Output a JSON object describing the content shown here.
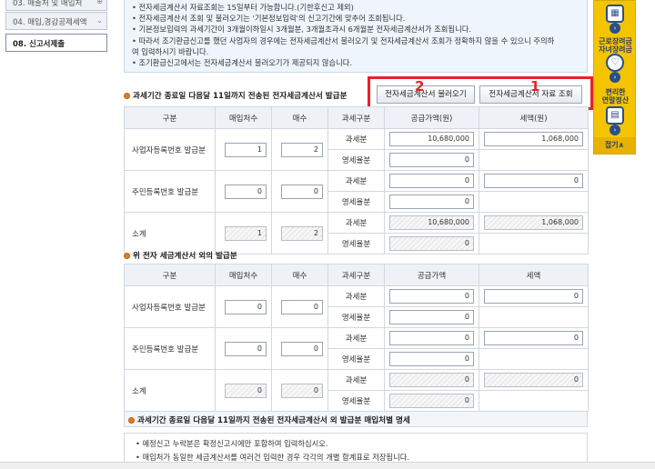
{
  "nav": {
    "item_partial": "03. 매출처 및 매입처",
    "item_deduction": "04. 매입,경감공제세액",
    "item_submit": "08. 신고서제출"
  },
  "notice": [
    "전자세금계산서 자료조회는 15일부터 가능합니다.(기한후신고 제외)",
    "전자세금계산서 조회 및 불러오기는 '기본정보입력'의 신고기간에 맞추어 조회됩니다.",
    "기본정보입력의 과세기간이 3개월이하일시 3개월분, 3개월초과시 6개월분 전자세금계산서가 조회됩니다.",
    "따라서 조기환급신고를 했던 사업자의 경우에는 전자세금계산서 불러오기 및 전자세금계산서 조회가 정확하지 않을 수 있으니 주의하",
    "여 입력하시기 바랍니다.",
    "조기환급신고에서는 전자세금계산서 불러오기가 제공되지 않습니다."
  ],
  "section1_title": "과세기간 종료일 다음달 11일까지 전송된 전자세금계산서 발급분",
  "buttons": {
    "load": "전자세금계산서 불러오기",
    "query": "전자세금계산서 자료 조회"
  },
  "marks": {
    "one": "1",
    "two": "2"
  },
  "table1": {
    "headers": [
      "구분",
      "매입처수",
      "매수",
      "과세구분",
      "공급가액(원)",
      "세액(원)"
    ],
    "rows": [
      {
        "label": "사업자등록번호 발급분",
        "count": "1",
        "sheets": "2",
        "tax_type": "과세분",
        "supply": "10,680,000",
        "tax": "1,068,000",
        "zero_type": "영세율분",
        "zero_supply": "0"
      },
      {
        "label": "주민등록번호 발급분",
        "count": "0",
        "sheets": "0",
        "tax_type": "과세분",
        "supply": "0",
        "tax": "0",
        "zero_type": "영세율분",
        "zero_supply": "0"
      },
      {
        "label": "소계",
        "count": "1",
        "sheets": "2",
        "tax_type": "과세분",
        "supply": "10,680,000",
        "tax": "1,068,000",
        "zero_type": "영세율분",
        "zero_supply": "0"
      }
    ]
  },
  "section2_title": "위 전자 세금계산서 외의 발급분",
  "table2": {
    "headers": [
      "구분",
      "매입처수",
      "매수",
      "과세구분",
      "공급가액",
      "세액"
    ],
    "rows": [
      {
        "label": "사업자등록번호 발급분",
        "count": "0",
        "sheets": "0",
        "tax_type": "과세분",
        "supply": "0",
        "tax": "0",
        "zero_type": "영세율분",
        "zero_supply": "0"
      },
      {
        "label": "주민등록번호 발급분",
        "count": "0",
        "sheets": "0",
        "tax_type": "과세분",
        "supply": "0",
        "tax": "0",
        "zero_type": "영세율분",
        "zero_supply": "0"
      },
      {
        "label": "소계",
        "count": "0",
        "sheets": "0",
        "tax_type": "과세분",
        "supply": "0",
        "tax": "0",
        "zero_type": "영세율분",
        "zero_supply": "0"
      }
    ]
  },
  "section3_title": "과세기간 종료일 다음달 11일까지 전송된 전자세금계산서 외 발급분 매입처별 명세",
  "notes": [
    "예정신고 누락분은 확정신고시에만 포함하여 입력하십시오.",
    "매입처가 동일한 세금계산서를 여러건 입력한 경우 각각의 개별 합계표로 저장됩니다."
  ],
  "rpanel": {
    "refund": "근로장려금\n자녀장려금",
    "settle1": "편리한",
    "settle2": "연말정산",
    "fold": "접기∧"
  },
  "colors": {
    "accent_red": "#e8202a",
    "panel_yellow": "#f5c400",
    "header_bg": "#eef2f6"
  }
}
